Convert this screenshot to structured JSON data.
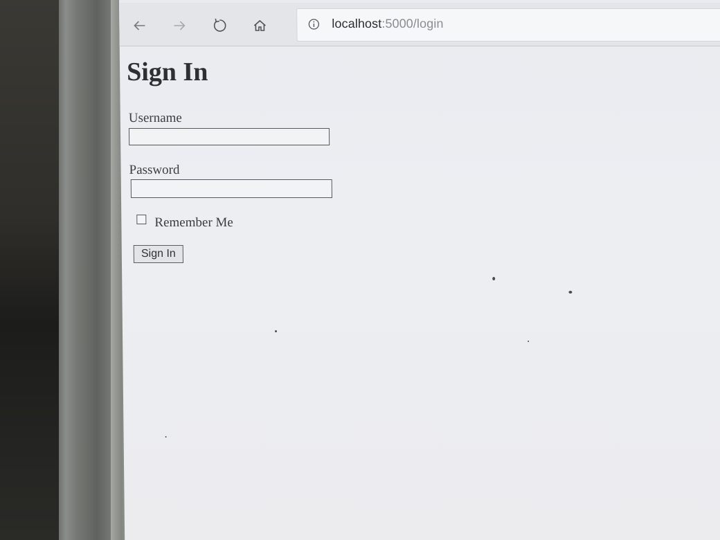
{
  "browser": {
    "url_host": "localhost",
    "url_port": ":5000",
    "url_path": "/login"
  },
  "page": {
    "title": "Sign In",
    "username_label": "Username",
    "username_value": "",
    "password_label": "Password",
    "password_value": "",
    "remember_label": "Remember Me",
    "remember_checked": false,
    "submit_label": "Sign In"
  },
  "icons": {
    "back": "back-arrow-icon",
    "forward": "forward-arrow-icon",
    "reload": "reload-icon",
    "home": "home-icon",
    "info": "info-icon"
  }
}
